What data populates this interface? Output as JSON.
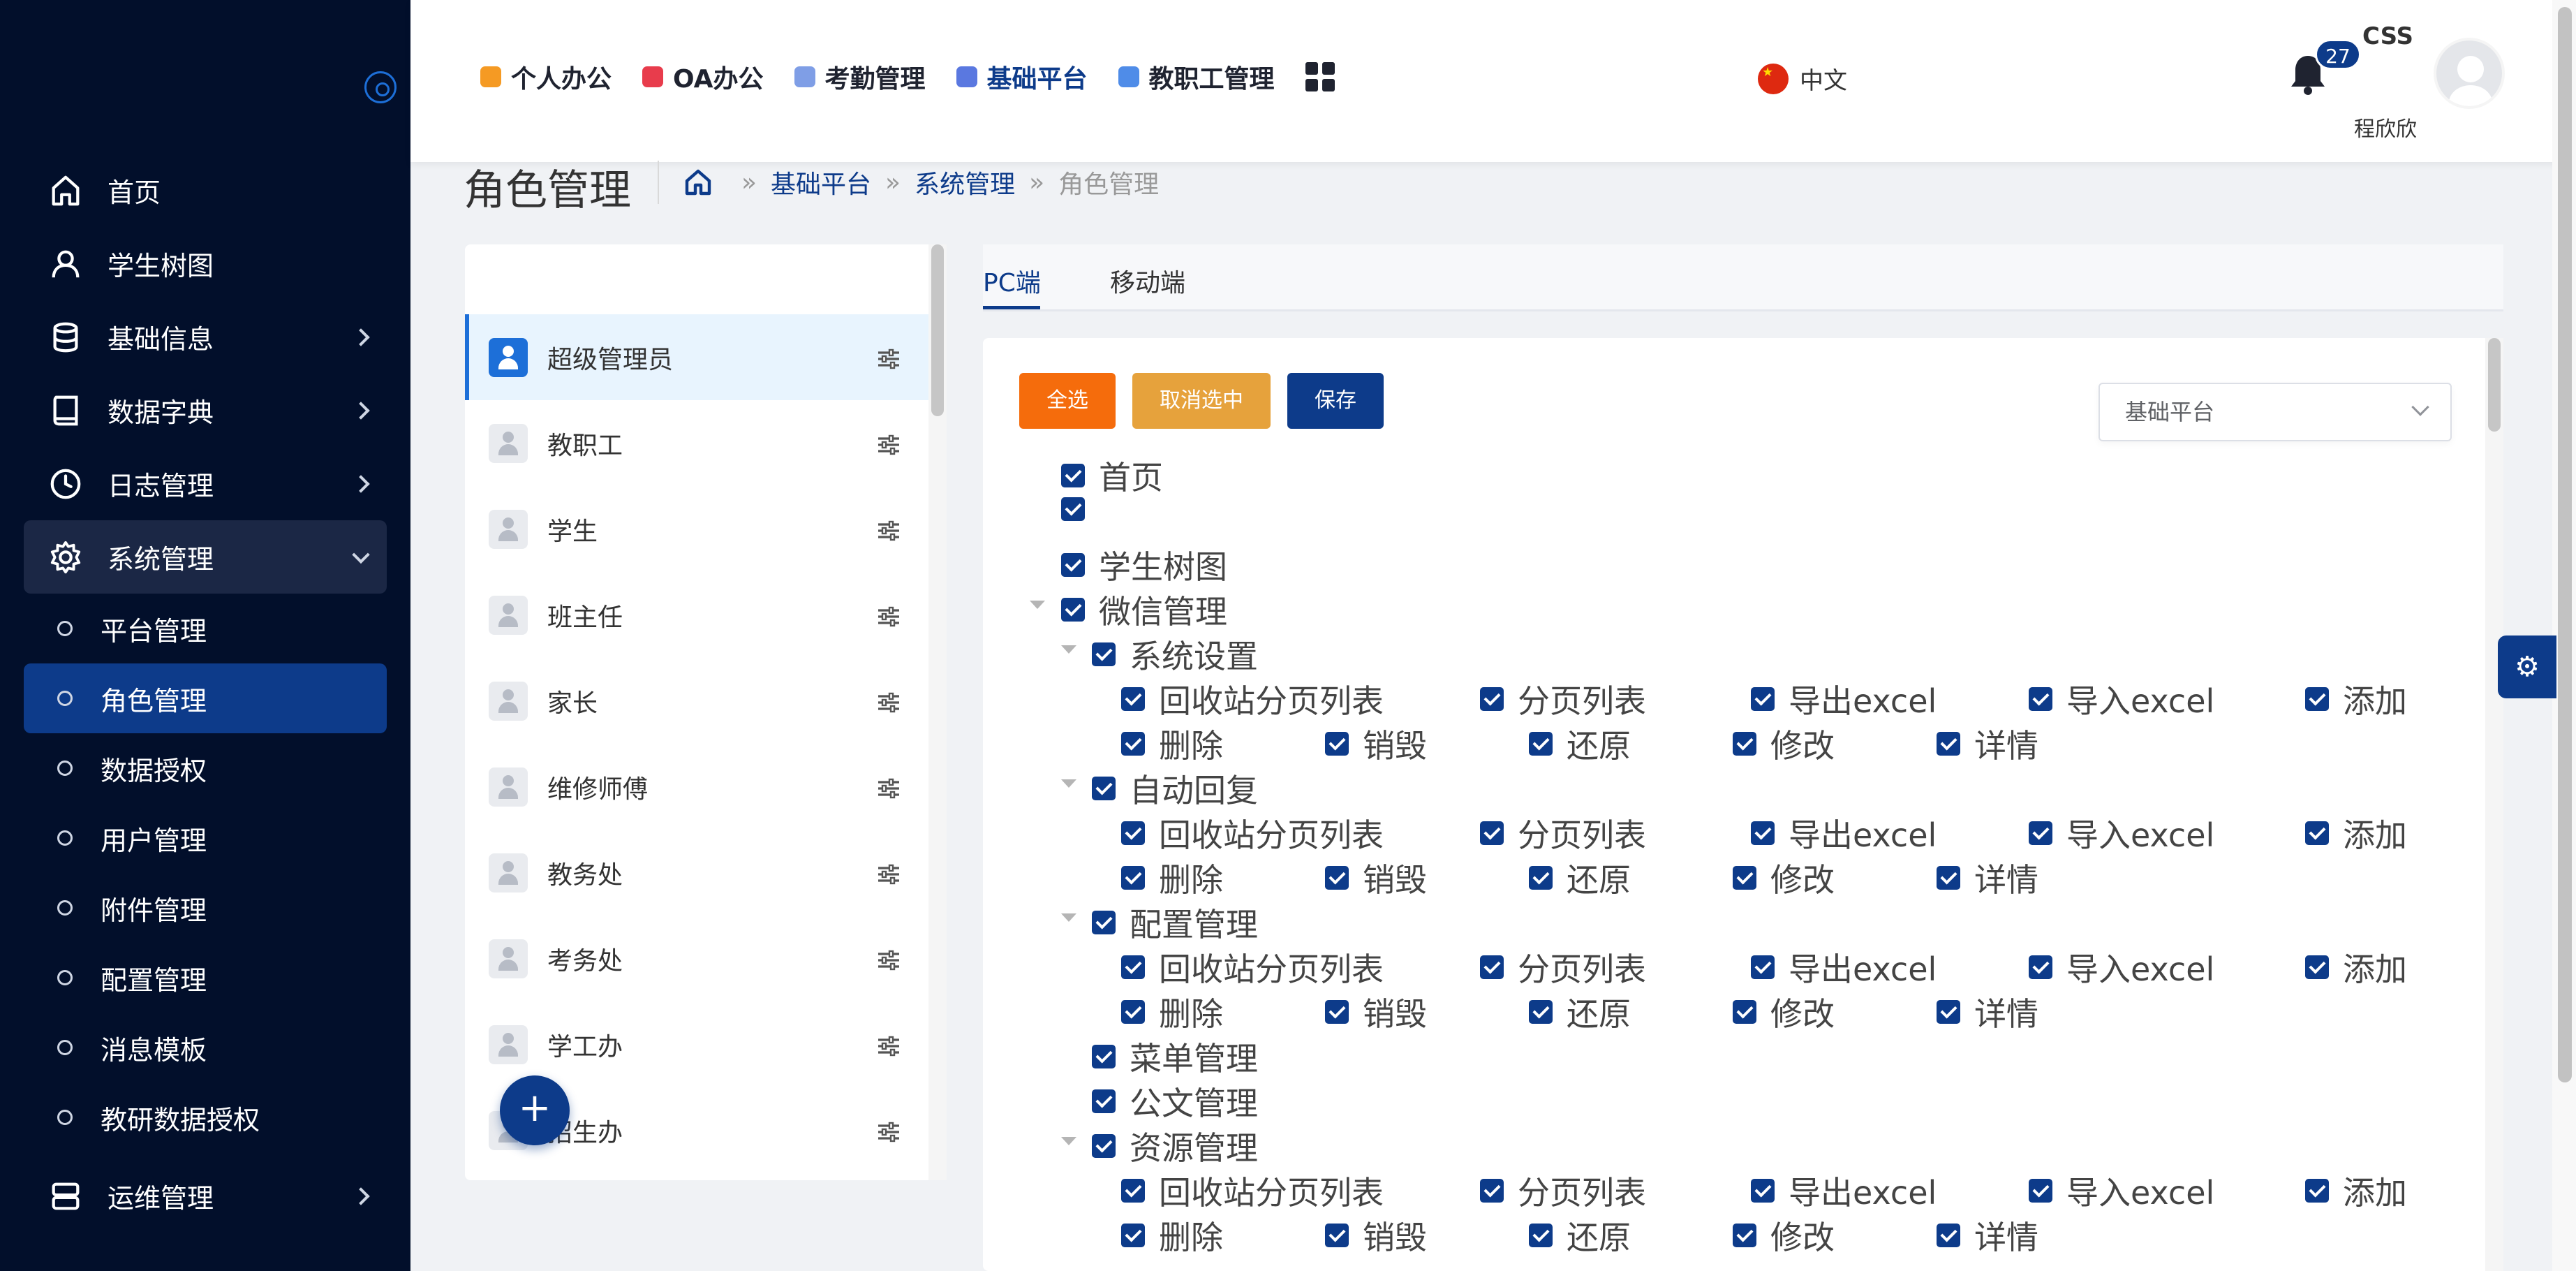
{
  "header": {
    "nav": [
      {
        "label": "个人办公",
        "icon": "briefcase-icon",
        "color": "#f59a23"
      },
      {
        "label": "OA办公",
        "icon": "oa-icon",
        "color": "#e83c4c"
      },
      {
        "label": "考勤管理",
        "icon": "attendance-icon",
        "color": "#7f9ee6"
      },
      {
        "label": "基础平台",
        "icon": "platform-icon",
        "color": "#5a78e0"
      },
      {
        "label": "教职工管理",
        "icon": "staff-icon",
        "color": "#4f8ce8"
      }
    ],
    "language": "中文",
    "notification_count": "27",
    "tag": "CSS",
    "username": "程欣欣"
  },
  "sidebar": {
    "items": [
      {
        "label": "首页",
        "icon": "home-icon",
        "has_arrow": false
      },
      {
        "label": "学生树图",
        "icon": "user-icon",
        "has_arrow": false
      },
      {
        "label": "基础信息",
        "icon": "database-icon",
        "has_arrow": true
      },
      {
        "label": "数据字典",
        "icon": "book-icon",
        "has_arrow": true
      },
      {
        "label": "日志管理",
        "icon": "clock-icon",
        "has_arrow": true
      },
      {
        "label": "系统管理",
        "icon": "gear-icon",
        "has_arrow": true,
        "open": true
      }
    ],
    "subitems": [
      "平台管理",
      "角色管理",
      "数据授权",
      "用户管理",
      "附件管理",
      "配置管理",
      "消息模板",
      "教研数据授权"
    ],
    "active_subitem": "角色管理",
    "bottom_item": {
      "label": "运维管理",
      "icon": "server-icon"
    }
  },
  "page": {
    "title": "角色管理",
    "breadcrumb": [
      "基础平台",
      "系统管理",
      "角色管理"
    ]
  },
  "roles": [
    "超级管理员",
    "教职工",
    "学生",
    "班主任",
    "家长",
    "维修师傅",
    "教务处",
    "考务处",
    "学工办",
    "招生办"
  ],
  "active_role": "超级管理员",
  "tabs": [
    "PC端",
    "移动端"
  ],
  "active_tab": "PC端",
  "actions": {
    "select_all": "全选",
    "deselect": "取消选中",
    "save": "保存"
  },
  "platform_select": {
    "value": "基础平台"
  },
  "tree": {
    "top": [
      "首页",
      "",
      "学生树图"
    ],
    "wechat": {
      "label": "微信管理",
      "groups": [
        {
          "label": "系统设置",
          "row1": [
            "回收站分页列表",
            "分页列表",
            "导出excel",
            "导入excel",
            "添加"
          ],
          "row2": [
            "删除",
            "销毁",
            "还原",
            "修改",
            "详情"
          ]
        },
        {
          "label": "自动回复",
          "row1": [
            "回收站分页列表",
            "分页列表",
            "导出excel",
            "导入excel",
            "添加"
          ],
          "row2": [
            "删除",
            "销毁",
            "还原",
            "修改",
            "详情"
          ]
        },
        {
          "label": "配置管理",
          "row1": [
            "回收站分页列表",
            "分页列表",
            "导出excel",
            "导入excel",
            "添加"
          ],
          "row2": [
            "删除",
            "销毁",
            "还原",
            "修改",
            "详情"
          ]
        }
      ],
      "leaves": [
        "菜单管理",
        "公文管理"
      ],
      "resource": {
        "label": "资源管理",
        "row1": [
          "回收站分页列表",
          "分页列表",
          "导出excel",
          "导入excel",
          "添加"
        ],
        "row2": [
          "删除",
          "销毁",
          "还原",
          "修改",
          "详情"
        ]
      }
    }
  },
  "colors": {
    "sidebar_bg": "#020f2b",
    "accent": "#0d3b8a",
    "select_all_btn": "#f56c0c",
    "deselect_btn": "#e6a23c"
  }
}
